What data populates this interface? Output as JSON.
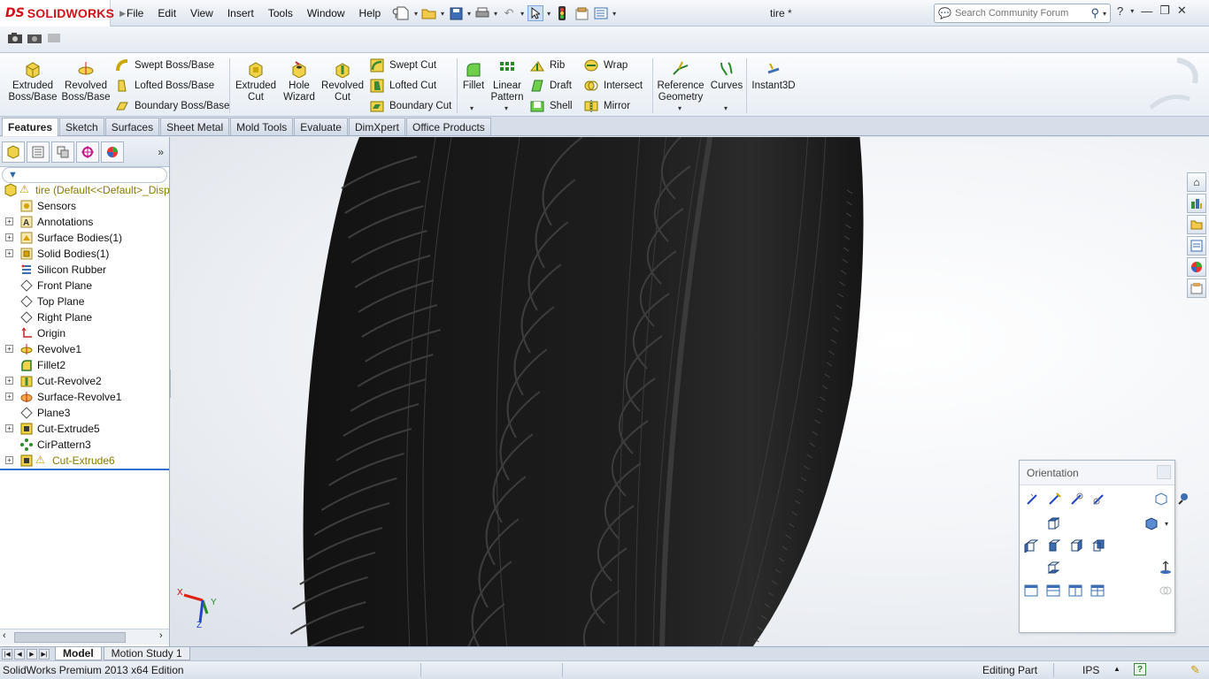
{
  "app": {
    "logo_prefix": "DS",
    "logo_text": "SOLIDWORKS",
    "document_title": "tire *"
  },
  "menu": [
    "File",
    "Edit",
    "View",
    "Insert",
    "Tools",
    "Window",
    "Help"
  ],
  "search": {
    "placeholder": "Search Community Forum"
  },
  "ribbon": {
    "extruded_boss": "Extruded Boss/Base",
    "revolved_boss": "Revolved Boss/Base",
    "swept_boss": "Swept Boss/Base",
    "lofted_boss": "Lofted Boss/Base",
    "boundary_boss": "Boundary Boss/Base",
    "extruded_cut": "Extruded Cut",
    "hole_wizard": "Hole Wizard",
    "revolved_cut": "Revolved Cut",
    "swept_cut": "Swept Cut",
    "lofted_cut": "Lofted Cut",
    "boundary_cut": "Boundary Cut",
    "fillet": "Fillet",
    "linear_pattern": "Linear Pattern",
    "rib": "Rib",
    "draft": "Draft",
    "shell": "Shell",
    "wrap": "Wrap",
    "intersect": "Intersect",
    "mirror": "Mirror",
    "reference_geometry": "Reference Geometry",
    "curves": "Curves",
    "instant3d": "Instant3D"
  },
  "tabs": [
    "Features",
    "Sketch",
    "Surfaces",
    "Sheet Metal",
    "Mold Tools",
    "Evaluate",
    "DimXpert",
    "Office Products"
  ],
  "active_tab": "Features",
  "feature_tree": {
    "root": "tire  (Default<<Default>_Disp",
    "items": [
      {
        "label": "Sensors",
        "icon": "sensor-icon",
        "expandable": false
      },
      {
        "label": "Annotations",
        "icon": "annotation-icon",
        "expandable": true
      },
      {
        "label": "Surface Bodies(1)",
        "icon": "surface-bodies-icon",
        "expandable": true
      },
      {
        "label": "Solid Bodies(1)",
        "icon": "solid-bodies-icon",
        "expandable": true
      },
      {
        "label": "Silicon Rubber",
        "icon": "material-icon",
        "expandable": false
      },
      {
        "label": "Front Plane",
        "icon": "plane-icon",
        "expandable": false
      },
      {
        "label": "Top Plane",
        "icon": "plane-icon",
        "expandable": false
      },
      {
        "label": "Right Plane",
        "icon": "plane-icon",
        "expandable": false
      },
      {
        "label": "Origin",
        "icon": "origin-icon",
        "expandable": false
      },
      {
        "label": "Revolve1",
        "icon": "revolve-icon",
        "expandable": true
      },
      {
        "label": "Fillet2",
        "icon": "fillet-icon",
        "expandable": false
      },
      {
        "label": "Cut-Revolve2",
        "icon": "cut-revolve-icon",
        "expandable": true
      },
      {
        "label": "Surface-Revolve1",
        "icon": "surface-revolve-icon",
        "expandable": true
      },
      {
        "label": "Plane3",
        "icon": "plane-icon",
        "expandable": false
      },
      {
        "label": "Cut-Extrude5",
        "icon": "cut-extrude-icon",
        "expandable": true
      },
      {
        "label": "CirPattern3",
        "icon": "circular-pattern-icon",
        "expandable": false
      },
      {
        "label": "Cut-Extrude6",
        "icon": "cut-extrude-icon",
        "expandable": true,
        "warning": true
      }
    ]
  },
  "orientation": {
    "title": "Orientation"
  },
  "triad": {
    "x": "X",
    "y": "Y",
    "z": "Z"
  },
  "bottom_tabs": [
    "Model",
    "Motion Study 1"
  ],
  "status": {
    "edition": "SolidWorks Premium 2013 x64 Edition",
    "mode": "Editing Part",
    "units": "IPS"
  },
  "colors": {
    "brand_red": "#d4121a",
    "tire": "#1b1b1b",
    "rollback_bar": "#2f6fd0"
  }
}
